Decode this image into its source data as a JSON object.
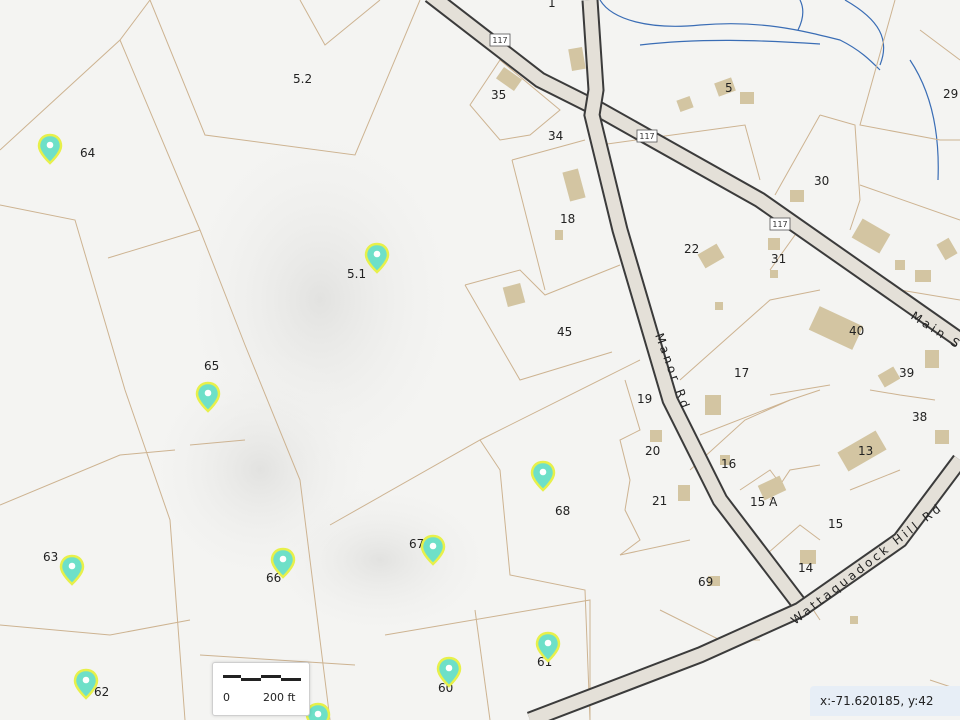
{
  "map": {
    "parcels": [
      "5.2",
      "64",
      "35",
      "34",
      "5",
      "29",
      "30",
      "18",
      "22",
      "31",
      "5.1",
      "45",
      "40",
      "17",
      "39",
      "38",
      "65",
      "19",
      "13",
      "20",
      "16",
      "68",
      "21",
      "15 A",
      "15",
      "63",
      "67",
      "66",
      "14",
      "69",
      "62",
      "60",
      "61",
      "1"
    ],
    "roads": {
      "route_shield": "117",
      "manor": "Manor Rd",
      "main": "Main S",
      "wattaquadock": "Wattaquadock Hill Rd"
    },
    "markers": [
      "64",
      "5.1",
      "65",
      "68",
      "63",
      "66",
      "67",
      "62",
      "60",
      "61"
    ],
    "colors": {
      "parcel_line": "#cdb391",
      "road_fill": "#e4e0d8",
      "road_edge": "#3b3b3b",
      "building": "#d3c5a2",
      "stream": "#3a6db5",
      "marker_fill": "#6ee0c8",
      "marker_stroke": "#e7f04a"
    }
  },
  "scale": {
    "zero": "0",
    "distance": "200 ft"
  },
  "coordinates": "x:-71.620185, y:42"
}
